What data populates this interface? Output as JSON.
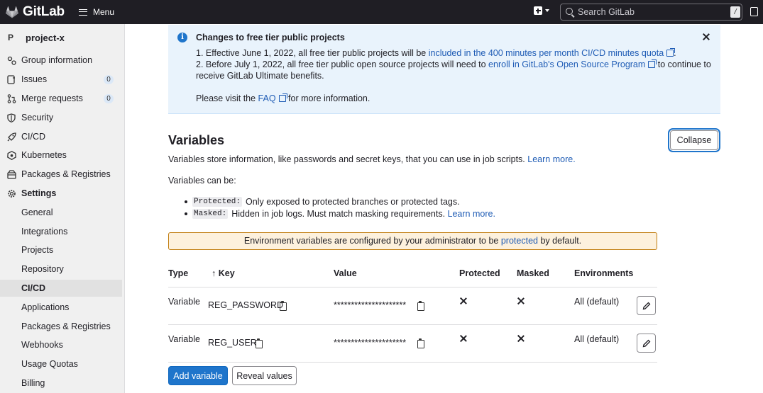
{
  "topbar": {
    "brand": "GitLab",
    "menu_label": "Menu",
    "search_placeholder": "Search GitLab",
    "search_shortcut": "/"
  },
  "sidebar": {
    "project_initial": "P",
    "project_name": "project-x",
    "items": [
      {
        "label": "Group information",
        "icon": "group-icon"
      },
      {
        "label": "Issues",
        "icon": "issues-icon",
        "badge": "0"
      },
      {
        "label": "Merge requests",
        "icon": "merge-request-icon",
        "badge": "0"
      },
      {
        "label": "Security",
        "icon": "shield-icon"
      },
      {
        "label": "CI/CD",
        "icon": "rocket-icon"
      },
      {
        "label": "Kubernetes",
        "icon": "kubernetes-icon"
      },
      {
        "label": "Packages & Registries",
        "icon": "package-icon"
      },
      {
        "label": "Settings",
        "icon": "gear-icon"
      }
    ],
    "settings_items": [
      "General",
      "Integrations",
      "Projects",
      "Repository",
      "CI/CD",
      "Applications",
      "Packages & Registries",
      "Webhooks",
      "Usage Quotas",
      "Billing"
    ],
    "active_settings_item": "CI/CD"
  },
  "banner": {
    "title": "Changes to free tier public projects",
    "line1_prefix": "1. Effective June 1, 2022, all free tier public projects will be ",
    "line1_link": "included in the 400 minutes per month CI/CD minutes quota",
    "line1_suffix": ".",
    "line2_prefix": "2. Before July 1, 2022, all free tier public open source projects will need to ",
    "line2_link": "enroll in GitLab's Open Source Program",
    "line2_suffix": " to continue to",
    "line3": "receive GitLab Ultimate benefits.",
    "faq_prefix": "Please visit the ",
    "faq_link": "FAQ",
    "faq_suffix": " for more information."
  },
  "variables": {
    "heading": "Variables",
    "collapse_label": "Collapse",
    "description_prefix": "Variables store information, like passwords and secret keys, that you can use in job scripts. ",
    "learn_more": "Learn more.",
    "can_be": "Variables can be:",
    "bullets": [
      {
        "code": "Protected:",
        "text": "Only exposed to protected branches or protected tags.",
        "link": ""
      },
      {
        "code": "Masked:",
        "text": "Hidden in job logs. Must match masking requirements. ",
        "link": "Learn more."
      }
    ],
    "warning_prefix": "Environment variables are configured by your administrator to be ",
    "warning_link": "protected",
    "warning_suffix": " by default.",
    "columns": [
      "Type",
      "↑ Key",
      "Value",
      "Protected",
      "Masked",
      "Environments"
    ],
    "rows": [
      {
        "type": "Variable",
        "key": "REG_PASSWORD",
        "value": "*********************",
        "protected": "×",
        "masked": "×",
        "environments": "All (default)"
      },
      {
        "type": "Variable",
        "key": "REG_USER",
        "value": "*********************",
        "protected": "×",
        "masked": "×",
        "environments": "All (default)"
      }
    ],
    "add_label": "Add variable",
    "reveal_label": "Reveal values"
  },
  "colors": {
    "topbar": "#1f1e24",
    "primary": "#1f75cb",
    "link": "#1f5cb5",
    "banner_bg": "#e9f3fc",
    "warning_bg": "#fdf1dd"
  }
}
